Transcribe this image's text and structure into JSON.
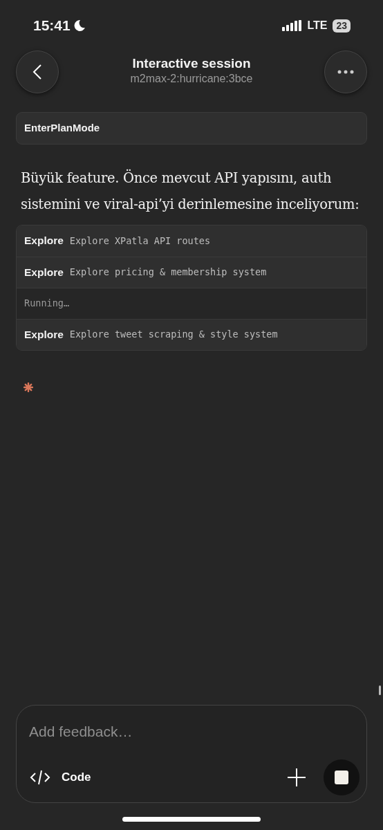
{
  "status_bar": {
    "time": "15:41",
    "network": "LTE",
    "battery": "23"
  },
  "header": {
    "title": "Interactive session",
    "subtitle": "m2max-2:hurricane:3bce"
  },
  "tool_call": {
    "label": "EnterPlanMode"
  },
  "message": "Büyük feature. Önce mevcut API yapısını, auth sistemini ve viral-api’yi derinlemesine inceliyorum:",
  "tasks": [
    {
      "kind": "task",
      "label": "Explore",
      "detail": "Explore XPatla API routes"
    },
    {
      "kind": "task",
      "label": "Explore",
      "detail": "Explore pricing & membership system"
    },
    {
      "kind": "status",
      "detail": "Running…"
    },
    {
      "kind": "task",
      "label": "Explore",
      "detail": "Explore tweet scraping & style system"
    }
  ],
  "composer": {
    "placeholder": "Add feedback…",
    "mode": "Code"
  }
}
